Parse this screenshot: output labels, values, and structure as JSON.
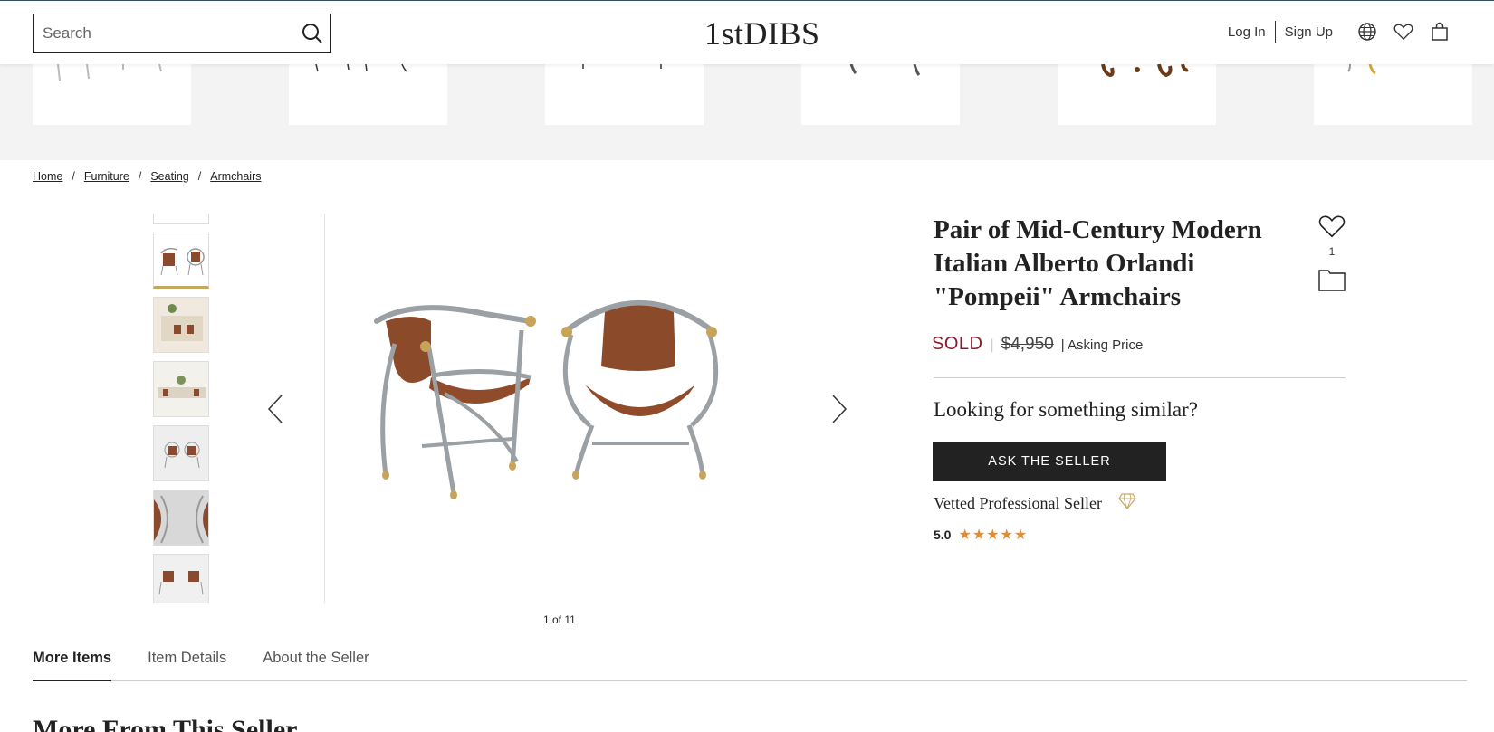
{
  "header": {
    "search_placeholder": "Search",
    "logo": "1stDIBS",
    "log_in": "Log In",
    "sign_up": "Sign Up"
  },
  "breadcrumb": [
    "Home",
    "Furniture",
    "Seating",
    "Armchairs"
  ],
  "gallery": {
    "counter": "1 of 11"
  },
  "product": {
    "title": "Pair of Mid-Century Modern Italian Alberto Orlandi \"Pompeii\" Armchairs",
    "favorite_count": "1",
    "status": "SOLD",
    "price": "$4,950",
    "price_sep": "|",
    "price_label": "| Asking Price",
    "similar_heading": "Looking for something similar?",
    "ask_button": "ASK THE SELLER",
    "seller_badge": "Vetted Professional Seller",
    "rating": "5.0",
    "stars": "★★★★★"
  },
  "tabs": [
    "More Items",
    "Item Details",
    "About the Seller"
  ],
  "section_heading": "More From This Seller",
  "colors": {
    "sold": "#8b1a2b",
    "star": "#e38c2c",
    "button": "#222222",
    "thumb_active": "#c6a961"
  }
}
